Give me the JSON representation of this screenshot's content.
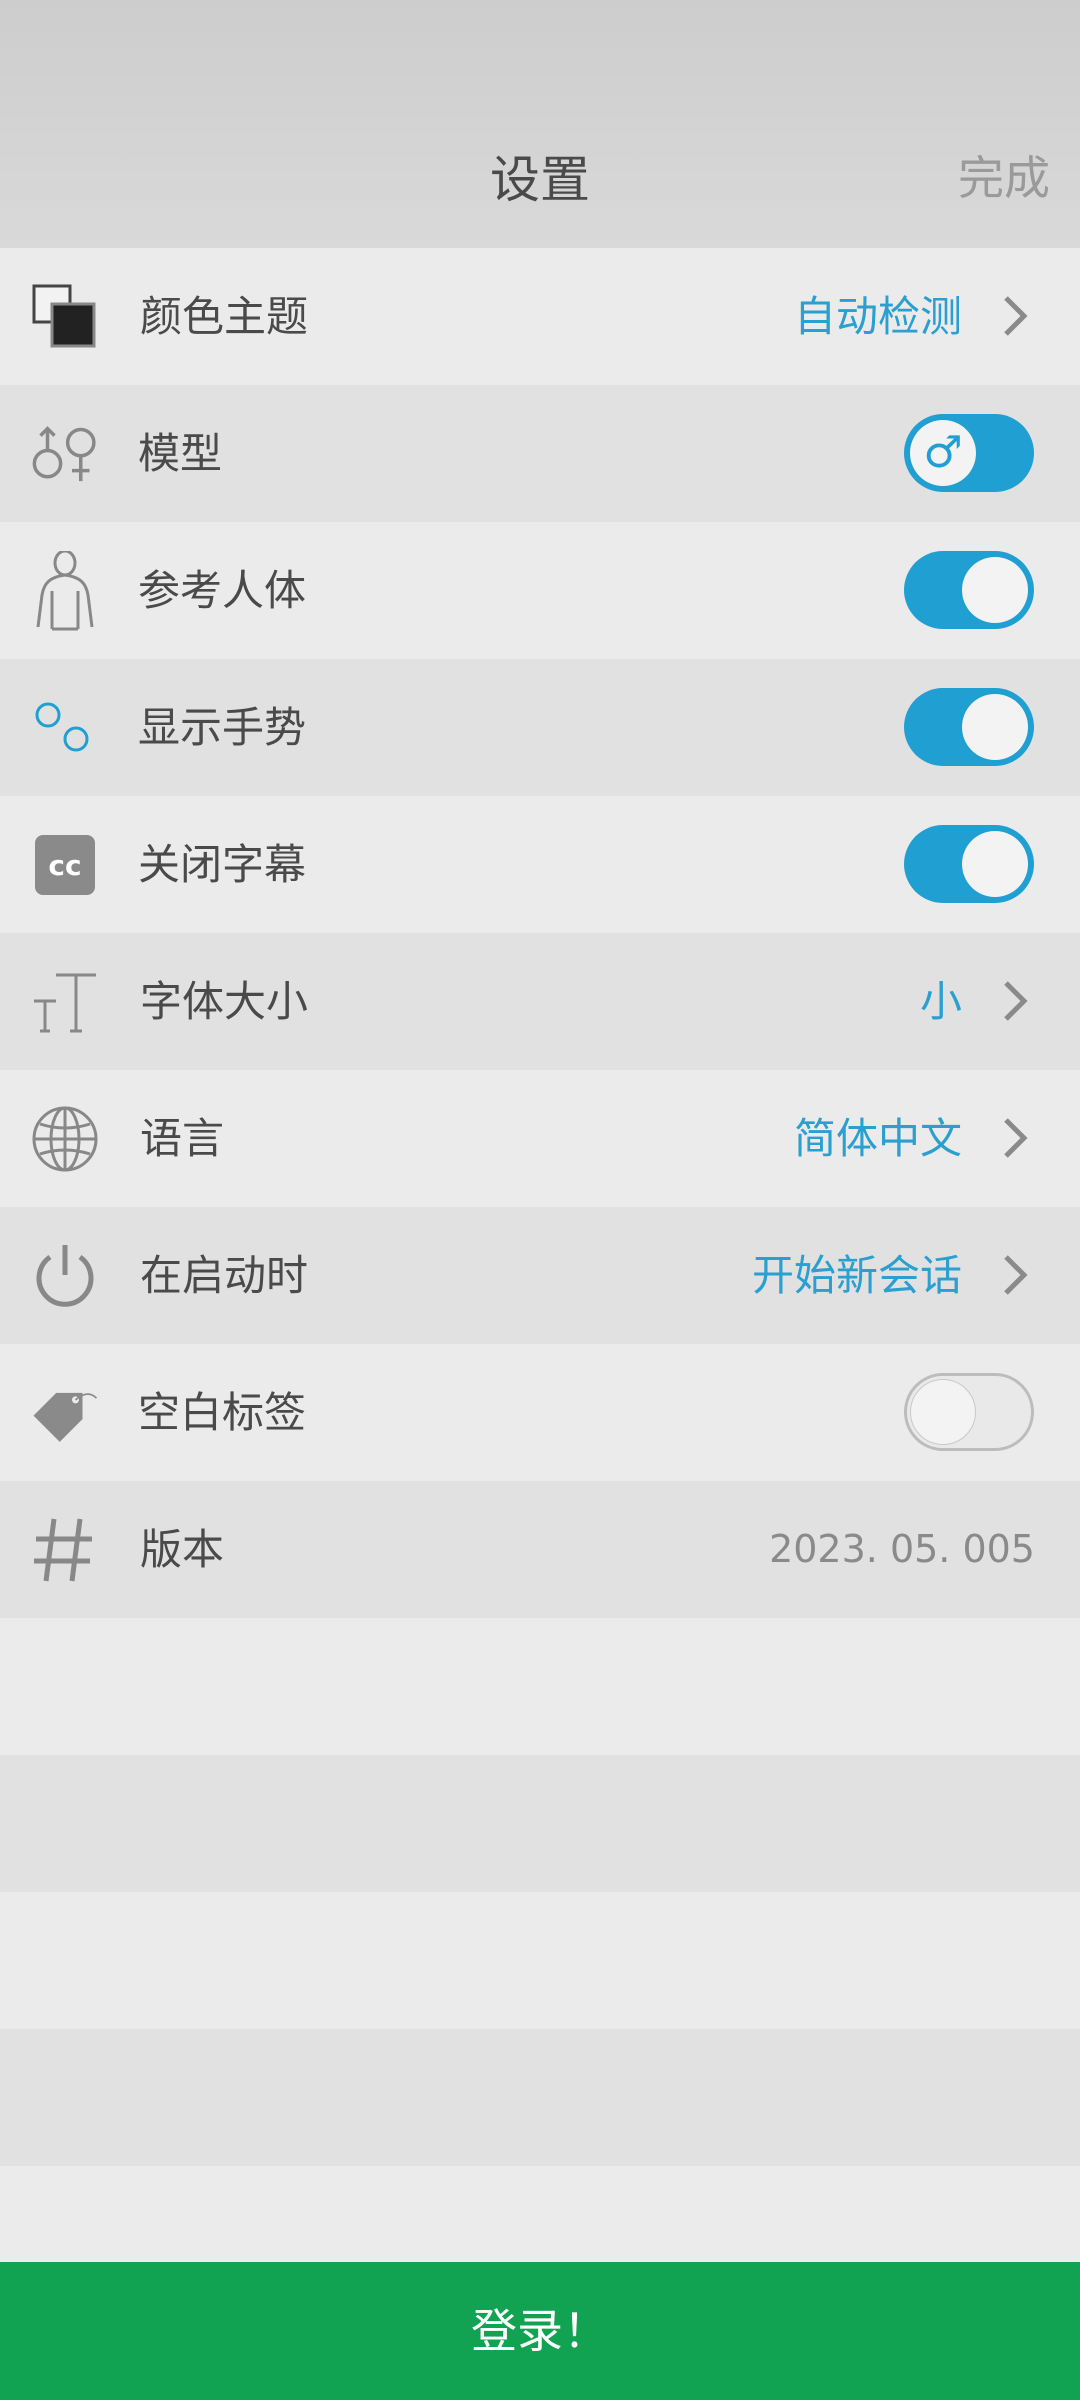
{
  "header": {
    "title": "设置",
    "done_label": "完成"
  },
  "settings": [
    {
      "name": "color-theme",
      "label": "颜色主题",
      "value": "自动检测",
      "icon": "color-theme-icon"
    },
    {
      "name": "model",
      "label": "模型",
      "toggle": true,
      "toggle_symbol": "♂",
      "icon": "gender-icon"
    },
    {
      "name": "reference-body",
      "label": "参考人体",
      "toggle": true,
      "icon": "human-body-icon"
    },
    {
      "name": "show-gestures",
      "label": "显示手势",
      "toggle": true,
      "icon": "gesture-icon"
    },
    {
      "name": "close-captions",
      "label": "关闭字幕",
      "toggle": true,
      "icon_text": "cc",
      "icon": "cc-icon"
    },
    {
      "name": "font-size",
      "label": "字体大小",
      "value": "小",
      "icon": "font-size-icon"
    },
    {
      "name": "language",
      "label": "语言",
      "value": "简体中文",
      "icon": "globe-icon"
    },
    {
      "name": "on-startup",
      "label": "在启动时",
      "value": "开始新会话",
      "icon": "power-icon"
    },
    {
      "name": "blank-labels",
      "label": "空白标签",
      "toggle": false,
      "icon": "tag-icon"
    },
    {
      "name": "version",
      "label": "版本",
      "value": "2023. 05. 005",
      "icon": "hash-icon"
    }
  ],
  "login_label": "登录！",
  "colors": {
    "accent": "#209fd2",
    "login": "#12a352"
  }
}
